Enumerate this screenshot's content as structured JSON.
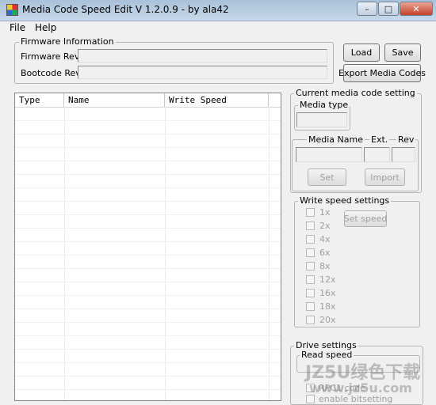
{
  "window": {
    "title": "Media Code Speed Edit V 1.2.0.9 - by ala42",
    "minimize": "–",
    "maximize": "□",
    "close": "✕"
  },
  "menu": [
    "File",
    "Help"
  ],
  "firmware": {
    "group_label": "Firmware Information",
    "fw_label": "Firmware Rev.",
    "fw_value": "",
    "boot_label": "Bootcode Rev.",
    "boot_value": ""
  },
  "buttons": {
    "load": "Load",
    "save": "Save",
    "export": "Export Media Codes"
  },
  "table": {
    "columns": [
      "Type",
      "Name",
      "Write Speed"
    ],
    "rows": []
  },
  "media_code": {
    "group_label": "Current media code setting",
    "media_type_label": "Media type",
    "media_name_label": "Media Name",
    "ext_label": "Ext.",
    "rev_label": "Rev",
    "set_button": "Set",
    "import_button": "Import"
  },
  "write_speed": {
    "group_label": "Write speed settings",
    "speeds": [
      "1x",
      "2x",
      "4x",
      "6x",
      "8x",
      "12x",
      "16x",
      "18x",
      "20x"
    ],
    "set_speed_button": "Set speed"
  },
  "drive": {
    "group_label": "Drive settings",
    "read_speed_label": "Read speed",
    "option1": "RPC1 code",
    "option2": "enable bitsetting"
  },
  "watermark": {
    "line1": "JZ5U绿色下载",
    "line2": "www.jz5u.com"
  },
  "colors": {
    "titlebar": "#b9cfe4",
    "close_button": "#c4412d",
    "disabled_text": "#a0a0a0"
  }
}
